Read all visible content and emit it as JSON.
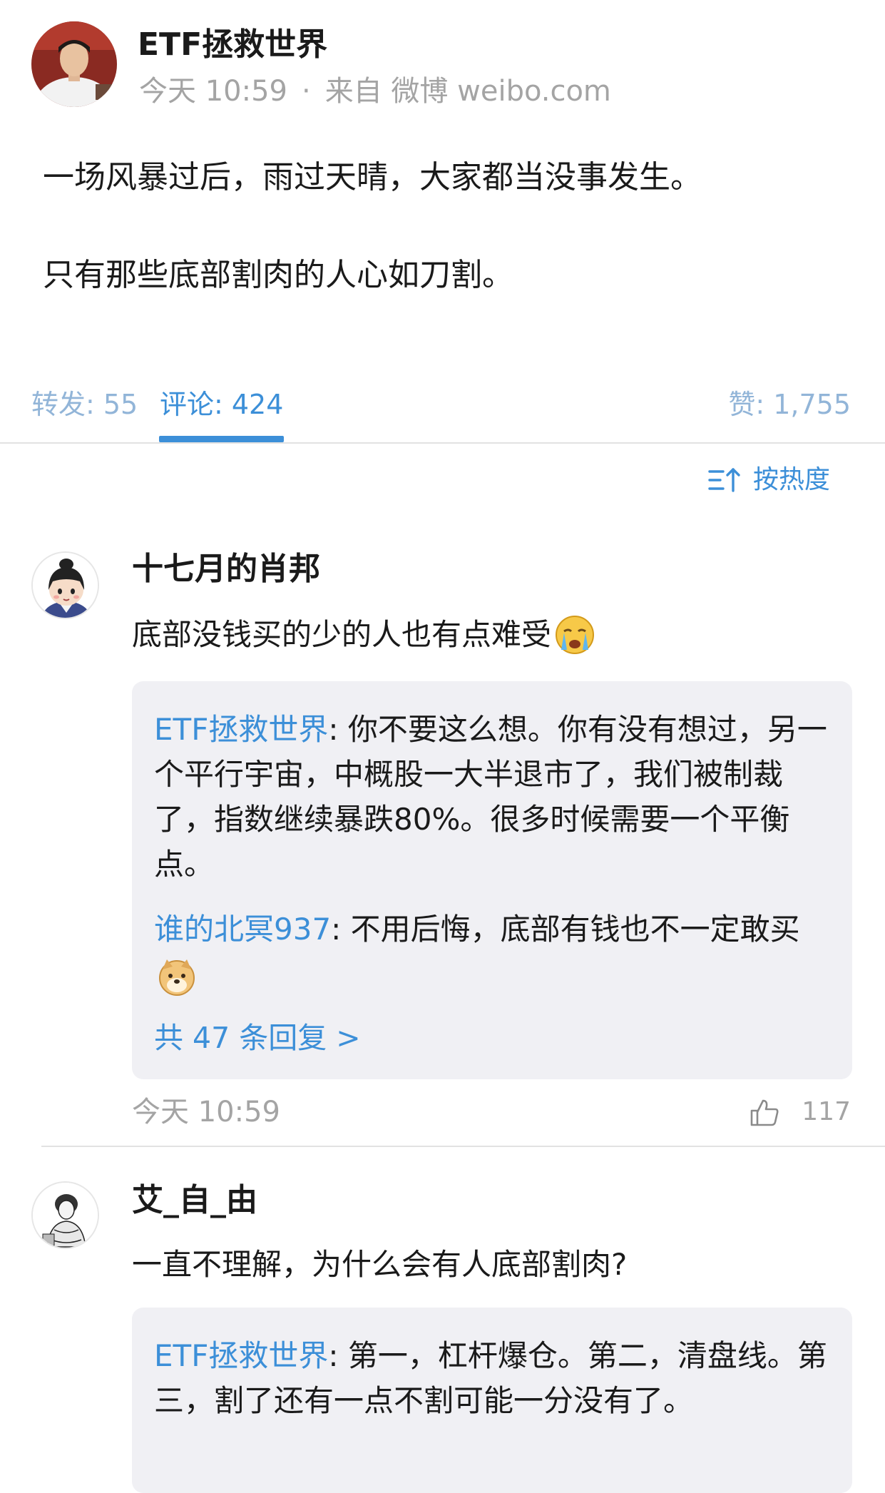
{
  "post": {
    "author": "ETF拯救世界",
    "time": "今天 10:59",
    "separator": "·",
    "source": "来自 微博 weibo.com",
    "paragraphs": [
      "一场风暴过后，雨过天晴，大家都当没事发生。",
      "只有那些底部割肉的人心如刀割。"
    ]
  },
  "tabs": {
    "repost": "转发: 55",
    "comment": "评论: 424",
    "like": "赞: 1,755",
    "active": "comment"
  },
  "sort": {
    "label": "按热度",
    "icon": "sort-icon"
  },
  "comments": [
    {
      "name": "十七月的肖邦",
      "text": "底部没钱买的少的人也有点难受",
      "emoji": "crying-face-icon",
      "replies": [
        {
          "user": "ETF拯救世界",
          "text": ": 你不要这么想。你有没有想过，另一个平行宇宙，中概股一大半退市了，我们被制裁了，指数继续暴跌80%。很多时候需要一个平衡点。"
        },
        {
          "user": "谁的北冥937",
          "text": ": 不用后悔，底部有钱也不一定敢买",
          "emoji": "doge-icon"
        }
      ],
      "reply_count": "共 47 条回复 >",
      "time": "今天 10:59",
      "likes": "117"
    },
    {
      "name": "艾_自_由",
      "text": "一直不理解，为什么会有人底部割肉?",
      "replies": [
        {
          "user": "ETF拯救世界",
          "text": ": 第一，杠杆爆仓。第二，清盘线。第三，割了还有一点不割可能一分没有了。"
        }
      ]
    }
  ],
  "colors": {
    "link": "#3c8fd8",
    "tab_inactive": "#92b5d8",
    "meta": "#a4a4a4",
    "reply_bg": "#f0f0f4"
  }
}
